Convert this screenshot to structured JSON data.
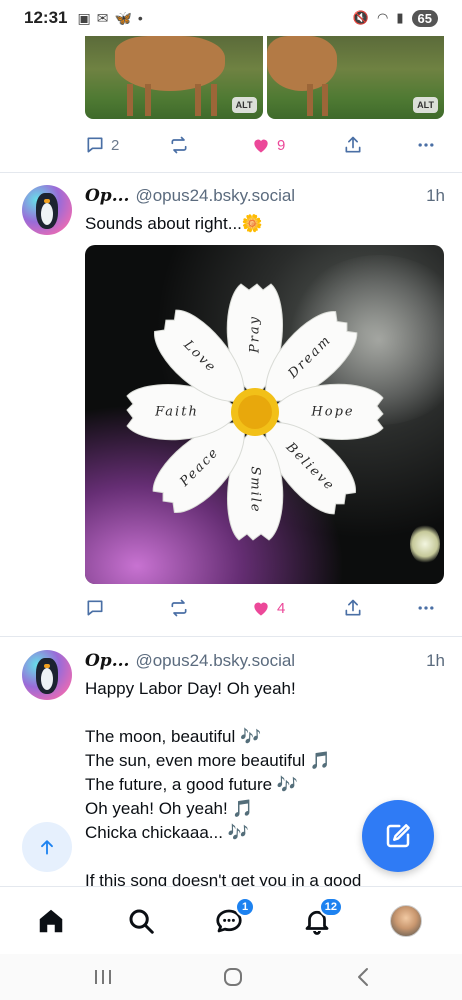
{
  "status_bar": {
    "time": "12:31",
    "battery": "65"
  },
  "prev_post": {
    "images": [
      {
        "alt_badge": "ALT"
      },
      {
        "alt_badge": "ALT"
      }
    ],
    "replies": "2",
    "likes": "9"
  },
  "post1": {
    "display_name": "Op...",
    "handle": "@opus24.bsky.social",
    "time": "1h",
    "text": "Sounds about right...🌼",
    "flower_words": [
      "Pray",
      "Dream",
      "Hope",
      "Believe",
      "Smile",
      "Peace",
      "Faith",
      "Love"
    ],
    "likes": "4"
  },
  "post2": {
    "display_name": "Op...",
    "handle": "@opus24.bsky.social",
    "time": "1h",
    "text": "Happy Labor Day! Oh yeah!\n\nThe moon, beautiful 🎶\nThe sun, even more beautiful 🎵\nThe future, a good future 🎶\nOh yeah! Oh yeah! 🎵\nChicka chickaaa... 🎶\n\nIf this song doesn't get you in a good"
  },
  "bottom_nav": {
    "messages_badge": "1",
    "notifications_badge": "12"
  },
  "colors": {
    "like": "#ec4899",
    "accent": "#2f7bf5",
    "muted": "#6b7a8d"
  }
}
